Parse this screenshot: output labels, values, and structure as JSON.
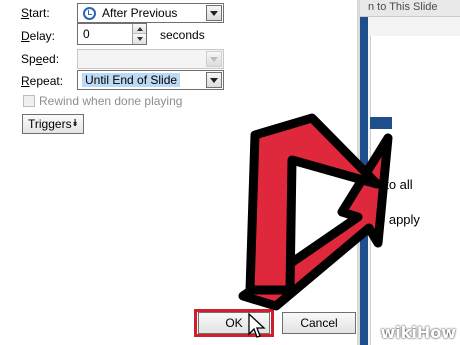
{
  "dialog": {
    "start": {
      "label": "Start:",
      "value": "After Previous"
    },
    "delay": {
      "label": "Delay:",
      "value": "0",
      "suffix": "seconds"
    },
    "speed": {
      "label": "Speed:",
      "value": ""
    },
    "repeat": {
      "label": "Repeat:",
      "value": "Until End of Slide"
    },
    "rewind": {
      "label": "Rewind when done playing",
      "checked": false
    },
    "triggers": {
      "label": "Triggers"
    },
    "ok": "OK",
    "cancel": "Cancel"
  },
  "background": {
    "tab_text": "n to This Slide",
    "line1": "t to all",
    "line2": "o apply"
  },
  "watermark": {
    "part1": "wiki",
    "part2": "How"
  },
  "colors": {
    "highlight_red": "#d01e2c",
    "arrow_red": "#e0283c",
    "navy": "#1f4e8c"
  }
}
